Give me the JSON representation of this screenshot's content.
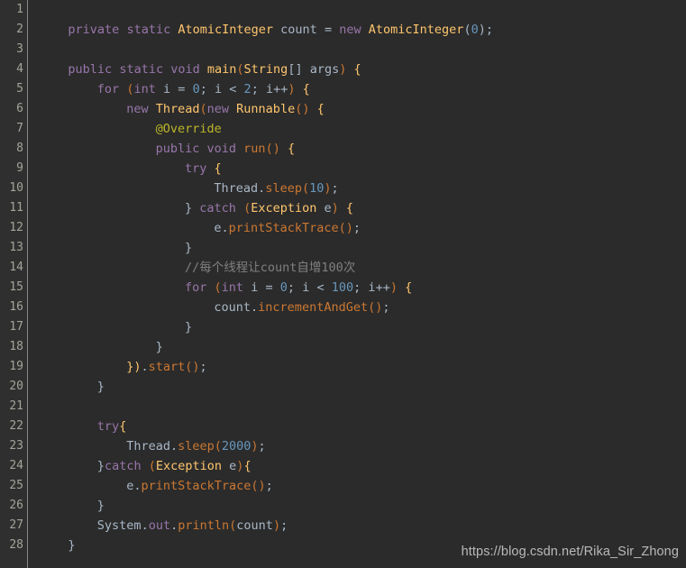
{
  "editor": {
    "language": "java",
    "background_color": "#2b2b2b",
    "gutter_color": "#2f2f2f",
    "line_number_color": "#a4a39a",
    "first_line": 1,
    "last_line": 28,
    "line_height_px": 22
  },
  "line_numbers": [
    1,
    2,
    3,
    4,
    5,
    6,
    7,
    8,
    9,
    10,
    11,
    12,
    13,
    14,
    15,
    16,
    17,
    18,
    19,
    20,
    21,
    22,
    23,
    24,
    25,
    26,
    27,
    28
  ],
  "palette": {
    "keyword_orange": "#cc7832",
    "keyword_purple": "#9876aa",
    "type_gold": "#ffc66d",
    "identifier": "#a9b7c6",
    "number_blue": "#6897bb",
    "comment_grey": "#808080",
    "annotation_olive": "#bbb529",
    "method_call_orange": "#cc7832"
  },
  "code_lines": [
    {
      "n": 1,
      "indent": 0,
      "tokens": []
    },
    {
      "n": 2,
      "indent": 4,
      "tokens": [
        {
          "t": "private",
          "c": "kwp"
        },
        {
          "t": " ",
          "c": "op"
        },
        {
          "t": "static",
          "c": "kwp"
        },
        {
          "t": " ",
          "c": "op"
        },
        {
          "t": "AtomicInteger",
          "c": "type"
        },
        {
          "t": " ",
          "c": "op"
        },
        {
          "t": "count",
          "c": "id"
        },
        {
          "t": " ",
          "c": "op"
        },
        {
          "t": "=",
          "c": "op"
        },
        {
          "t": " ",
          "c": "op"
        },
        {
          "t": "new",
          "c": "kwp"
        },
        {
          "t": " ",
          "c": "op"
        },
        {
          "t": "AtomicInteger",
          "c": "type"
        },
        {
          "t": "(",
          "c": "punc"
        },
        {
          "t": "0",
          "c": "num"
        },
        {
          "t": ")",
          "c": "punc"
        },
        {
          "t": ";",
          "c": "punc"
        }
      ]
    },
    {
      "n": 3,
      "indent": 0,
      "tokens": []
    },
    {
      "n": 4,
      "indent": 4,
      "tokens": [
        {
          "t": "public",
          "c": "kwp"
        },
        {
          "t": " ",
          "c": "op"
        },
        {
          "t": "static",
          "c": "kwp"
        },
        {
          "t": " ",
          "c": "op"
        },
        {
          "t": "void",
          "c": "kwp"
        },
        {
          "t": " ",
          "c": "op"
        },
        {
          "t": "main",
          "c": "fn"
        },
        {
          "t": "(",
          "c": "mcall"
        },
        {
          "t": "String",
          "c": "type"
        },
        {
          "t": "[]",
          "c": "punc"
        },
        {
          "t": " ",
          "c": "op"
        },
        {
          "t": "args",
          "c": "id"
        },
        {
          "t": ")",
          "c": "mcall"
        },
        {
          "t": " ",
          "c": "op"
        },
        {
          "t": "{",
          "c": "type"
        }
      ]
    },
    {
      "n": 5,
      "indent": 8,
      "tokens": [
        {
          "t": "for",
          "c": "kwp"
        },
        {
          "t": " ",
          "c": "op"
        },
        {
          "t": "(",
          "c": "mcall"
        },
        {
          "t": "int",
          "c": "kwp"
        },
        {
          "t": " ",
          "c": "op"
        },
        {
          "t": "i",
          "c": "id"
        },
        {
          "t": " ",
          "c": "op"
        },
        {
          "t": "=",
          "c": "op"
        },
        {
          "t": " ",
          "c": "op"
        },
        {
          "t": "0",
          "c": "num"
        },
        {
          "t": ";",
          "c": "punc"
        },
        {
          "t": " ",
          "c": "op"
        },
        {
          "t": "i",
          "c": "id"
        },
        {
          "t": " ",
          "c": "op"
        },
        {
          "t": "<",
          "c": "op"
        },
        {
          "t": " ",
          "c": "op"
        },
        {
          "t": "2",
          "c": "num"
        },
        {
          "t": ";",
          "c": "punc"
        },
        {
          "t": " ",
          "c": "op"
        },
        {
          "t": "i",
          "c": "id"
        },
        {
          "t": "++",
          "c": "op"
        },
        {
          "t": ")",
          "c": "mcall"
        },
        {
          "t": " ",
          "c": "op"
        },
        {
          "t": "{",
          "c": "type"
        }
      ]
    },
    {
      "n": 6,
      "indent": 12,
      "tokens": [
        {
          "t": "new",
          "c": "kwp"
        },
        {
          "t": " ",
          "c": "op"
        },
        {
          "t": "Thread",
          "c": "type"
        },
        {
          "t": "(",
          "c": "mcall"
        },
        {
          "t": "new",
          "c": "kwp"
        },
        {
          "t": " ",
          "c": "op"
        },
        {
          "t": "Runnable",
          "c": "type"
        },
        {
          "t": "()",
          "c": "mcall"
        },
        {
          "t": " ",
          "c": "op"
        },
        {
          "t": "{",
          "c": "type"
        }
      ]
    },
    {
      "n": 7,
      "indent": 16,
      "tokens": [
        {
          "t": "@Override",
          "c": "anno"
        }
      ]
    },
    {
      "n": 8,
      "indent": 16,
      "tokens": [
        {
          "t": "public",
          "c": "kwp"
        },
        {
          "t": " ",
          "c": "op"
        },
        {
          "t": "void",
          "c": "kwp"
        },
        {
          "t": " ",
          "c": "op"
        },
        {
          "t": "run",
          "c": "mcall"
        },
        {
          "t": "()",
          "c": "mcall"
        },
        {
          "t": " ",
          "c": "op"
        },
        {
          "t": "{",
          "c": "type"
        }
      ]
    },
    {
      "n": 9,
      "indent": 20,
      "tokens": [
        {
          "t": "try",
          "c": "kwp"
        },
        {
          "t": " ",
          "c": "op"
        },
        {
          "t": "{",
          "c": "type"
        }
      ]
    },
    {
      "n": 10,
      "indent": 24,
      "tokens": [
        {
          "t": "Thread",
          "c": "id"
        },
        {
          "t": ".",
          "c": "punc"
        },
        {
          "t": "sleep",
          "c": "mcall"
        },
        {
          "t": "(",
          "c": "mcall"
        },
        {
          "t": "10",
          "c": "num"
        },
        {
          "t": ")",
          "c": "mcall"
        },
        {
          "t": ";",
          "c": "punc"
        }
      ]
    },
    {
      "n": 11,
      "indent": 20,
      "tokens": [
        {
          "t": "}",
          "c": "brace"
        },
        {
          "t": " ",
          "c": "op"
        },
        {
          "t": "catch",
          "c": "kwp"
        },
        {
          "t": " ",
          "c": "op"
        },
        {
          "t": "(",
          "c": "mcall"
        },
        {
          "t": "Exception",
          "c": "type"
        },
        {
          "t": " ",
          "c": "op"
        },
        {
          "t": "e",
          "c": "id"
        },
        {
          "t": ")",
          "c": "mcall"
        },
        {
          "t": " ",
          "c": "op"
        },
        {
          "t": "{",
          "c": "type"
        }
      ]
    },
    {
      "n": 12,
      "indent": 24,
      "tokens": [
        {
          "t": "e",
          "c": "id"
        },
        {
          "t": ".",
          "c": "punc"
        },
        {
          "t": "printStackTrace",
          "c": "mcall"
        },
        {
          "t": "()",
          "c": "mcall"
        },
        {
          "t": ";",
          "c": "punc"
        }
      ]
    },
    {
      "n": 13,
      "indent": 20,
      "tokens": [
        {
          "t": "}",
          "c": "brace"
        }
      ]
    },
    {
      "n": 14,
      "indent": 20,
      "tokens": [
        {
          "t": "//每个线程让count自增100次",
          "c": "cmt"
        }
      ]
    },
    {
      "n": 15,
      "indent": 20,
      "tokens": [
        {
          "t": "for",
          "c": "kwp"
        },
        {
          "t": " ",
          "c": "op"
        },
        {
          "t": "(",
          "c": "mcall"
        },
        {
          "t": "int",
          "c": "kwp"
        },
        {
          "t": " ",
          "c": "op"
        },
        {
          "t": "i",
          "c": "id"
        },
        {
          "t": " ",
          "c": "op"
        },
        {
          "t": "=",
          "c": "op"
        },
        {
          "t": " ",
          "c": "op"
        },
        {
          "t": "0",
          "c": "num"
        },
        {
          "t": ";",
          "c": "punc"
        },
        {
          "t": " ",
          "c": "op"
        },
        {
          "t": "i",
          "c": "id"
        },
        {
          "t": " ",
          "c": "op"
        },
        {
          "t": "<",
          "c": "op"
        },
        {
          "t": " ",
          "c": "op"
        },
        {
          "t": "100",
          "c": "num"
        },
        {
          "t": ";",
          "c": "punc"
        },
        {
          "t": " ",
          "c": "op"
        },
        {
          "t": "i",
          "c": "id"
        },
        {
          "t": "++",
          "c": "op"
        },
        {
          "t": ")",
          "c": "mcall"
        },
        {
          "t": " ",
          "c": "op"
        },
        {
          "t": "{",
          "c": "type"
        }
      ]
    },
    {
      "n": 16,
      "indent": 24,
      "tokens": [
        {
          "t": "count",
          "c": "id"
        },
        {
          "t": ".",
          "c": "punc"
        },
        {
          "t": "incrementAndGet",
          "c": "mcall"
        },
        {
          "t": "()",
          "c": "mcall"
        },
        {
          "t": ";",
          "c": "punc"
        }
      ]
    },
    {
      "n": 17,
      "indent": 20,
      "tokens": [
        {
          "t": "}",
          "c": "brace"
        }
      ]
    },
    {
      "n": 18,
      "indent": 16,
      "tokens": [
        {
          "t": "}",
          "c": "brace"
        }
      ]
    },
    {
      "n": 19,
      "indent": 12,
      "tokens": [
        {
          "t": "})",
          "c": "type"
        },
        {
          "t": ".",
          "c": "punc"
        },
        {
          "t": "start",
          "c": "mcall"
        },
        {
          "t": "()",
          "c": "mcall"
        },
        {
          "t": ";",
          "c": "punc"
        }
      ]
    },
    {
      "n": 20,
      "indent": 8,
      "tokens": [
        {
          "t": "}",
          "c": "brace"
        }
      ]
    },
    {
      "n": 21,
      "indent": 0,
      "tokens": []
    },
    {
      "n": 22,
      "indent": 8,
      "tokens": [
        {
          "t": "try",
          "c": "kwp"
        },
        {
          "t": "{",
          "c": "type"
        }
      ]
    },
    {
      "n": 23,
      "indent": 12,
      "tokens": [
        {
          "t": "Thread",
          "c": "id"
        },
        {
          "t": ".",
          "c": "punc"
        },
        {
          "t": "sleep",
          "c": "mcall"
        },
        {
          "t": "(",
          "c": "mcall"
        },
        {
          "t": "2000",
          "c": "num"
        },
        {
          "t": ")",
          "c": "mcall"
        },
        {
          "t": ";",
          "c": "punc"
        }
      ]
    },
    {
      "n": 24,
      "indent": 8,
      "tokens": [
        {
          "t": "}",
          "c": "brace"
        },
        {
          "t": "catch",
          "c": "kwp"
        },
        {
          "t": " ",
          "c": "op"
        },
        {
          "t": "(",
          "c": "mcall"
        },
        {
          "t": "Exception",
          "c": "type"
        },
        {
          "t": " ",
          "c": "op"
        },
        {
          "t": "e",
          "c": "id"
        },
        {
          "t": ")",
          "c": "mcall"
        },
        {
          "t": "{",
          "c": "type"
        }
      ]
    },
    {
      "n": 25,
      "indent": 12,
      "tokens": [
        {
          "t": "e",
          "c": "id"
        },
        {
          "t": ".",
          "c": "punc"
        },
        {
          "t": "printStackTrace",
          "c": "mcall"
        },
        {
          "t": "()",
          "c": "mcall"
        },
        {
          "t": ";",
          "c": "punc"
        }
      ]
    },
    {
      "n": 26,
      "indent": 8,
      "tokens": [
        {
          "t": "}",
          "c": "brace"
        }
      ]
    },
    {
      "n": 27,
      "indent": 8,
      "tokens": [
        {
          "t": "System",
          "c": "id"
        },
        {
          "t": ".",
          "c": "punc"
        },
        {
          "t": "out",
          "c": "fld"
        },
        {
          "t": ".",
          "c": "punc"
        },
        {
          "t": "println",
          "c": "mcall"
        },
        {
          "t": "(",
          "c": "mcall"
        },
        {
          "t": "count",
          "c": "id"
        },
        {
          "t": ")",
          "c": "mcall"
        },
        {
          "t": ";",
          "c": "punc"
        }
      ]
    },
    {
      "n": 28,
      "indent": 4,
      "tokens": [
        {
          "t": "}",
          "c": "brace"
        }
      ]
    }
  ],
  "watermark": {
    "text": "https://blog.csdn.net/Rika_Sir_Zhong"
  }
}
